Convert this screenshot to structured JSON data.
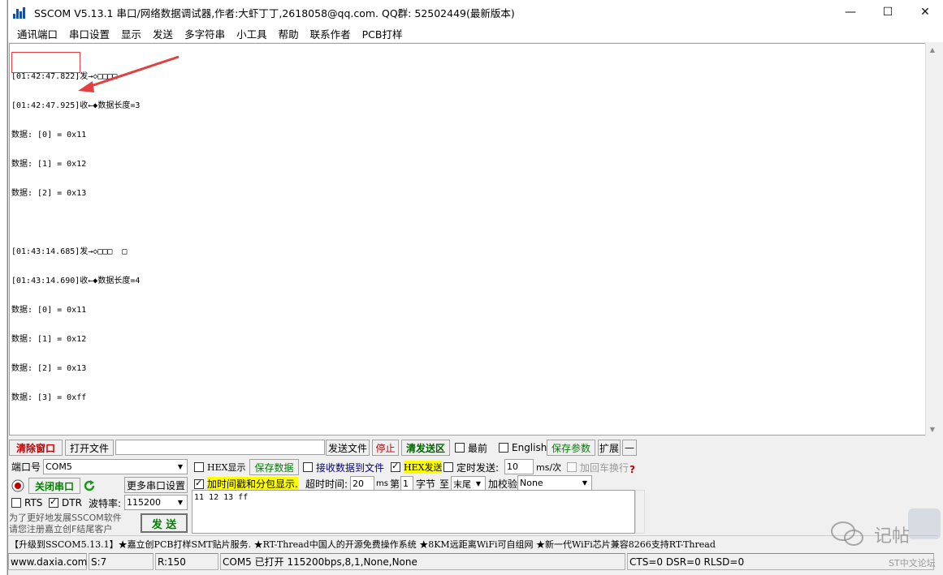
{
  "window": {
    "title": "SSCOM V5.13.1 串口/网络数据调试器,作者:大虾丁丁,2618058@qq.com. QQ群: 52502449(最新版本)",
    "minimize": "—",
    "maximize": "☐",
    "close": "✕"
  },
  "menu": [
    "通讯端口",
    "串口设置",
    "显示",
    "发送",
    "多字符串",
    "小工具",
    "帮助",
    "联系作者",
    "PCB打样"
  ],
  "receive_log": [
    "[01:42:47.822]发→◇□□□□",
    "[01:42:47.925]收←◆数据长度=3",
    "数据: [0] = 0x11",
    "数据: [1] = 0x12",
    "数据: [2] = 0x13",
    "",
    "[01:43:14.685]发→◇□□□  □",
    "[01:43:14.690]收←◆数据长度=4",
    "数据: [0] = 0x11",
    "数据: [1] = 0x12",
    "数据: [2] = 0x13",
    "数据: [3] = 0xff"
  ],
  "toolbar": {
    "clear_window": "清除窗口",
    "open_file": "打开文件",
    "send_file": "发送文件",
    "stop": "停止",
    "clear_send": "清发送区",
    "topmost": "最前",
    "english": "English",
    "save_params": "保存参数",
    "expand": "扩展",
    "collapse": "—"
  },
  "port": {
    "port_label": "端口号",
    "port_value": "COM5",
    "close_port": "关闭串口",
    "more_settings": "更多串口设置",
    "rts": "RTS",
    "dtr": "DTR",
    "baud_label": "波特率:",
    "baud_value": "115200",
    "promo_line1": "为了更好地发展SSCOM软件",
    "promo_line2": "请您注册嘉立创F结尾客户",
    "send_button": "发  送"
  },
  "options": {
    "hex_display": "HEX显示",
    "save_data": "保存数据",
    "recv_to_file": "接收数据到文件",
    "hex_send": "HEX发送",
    "timed_send": "定时发送:",
    "interval": "10",
    "interval_unit": "ms/次",
    "add_crlf": "加回车换行",
    "timestamp": "加时间戳和分包显示.",
    "timeout_label": "超时时间:",
    "timeout_value": "20",
    "timeout_unit": "ms",
    "nth_label": "第",
    "nth_value": "1",
    "byte_label": "字节",
    "to_label": "至",
    "end_value": "末尾",
    "checksum_label": "加校验",
    "checksum_value": "None",
    "help": "?"
  },
  "send_data": "11 12 13 ff",
  "marquee": "【升级到SSCOM5.13.1】★嘉立创PCB打样SMT贴片服务. ★RT-Thread中国人的开源免费操作系统 ★8KM远距离WiFi可自组网 ★新一代WiFi芯片兼容8266支持RT-Thread",
  "status": {
    "website": "www.daxia.com",
    "sent": "S:7",
    "received": "R:150",
    "port_state": "COM5 已打开  115200bps,8,1,None,None",
    "lines": "CTS=0 DSR=0 RLSD=0"
  },
  "watermark": {
    "text": "记帖",
    "forum": "ST中文论坛"
  },
  "colors": {
    "accent_red": "#c00000",
    "accent_green": "#008000",
    "highlight_yellow": "#ffff00",
    "annotation_red": "#e04040"
  }
}
